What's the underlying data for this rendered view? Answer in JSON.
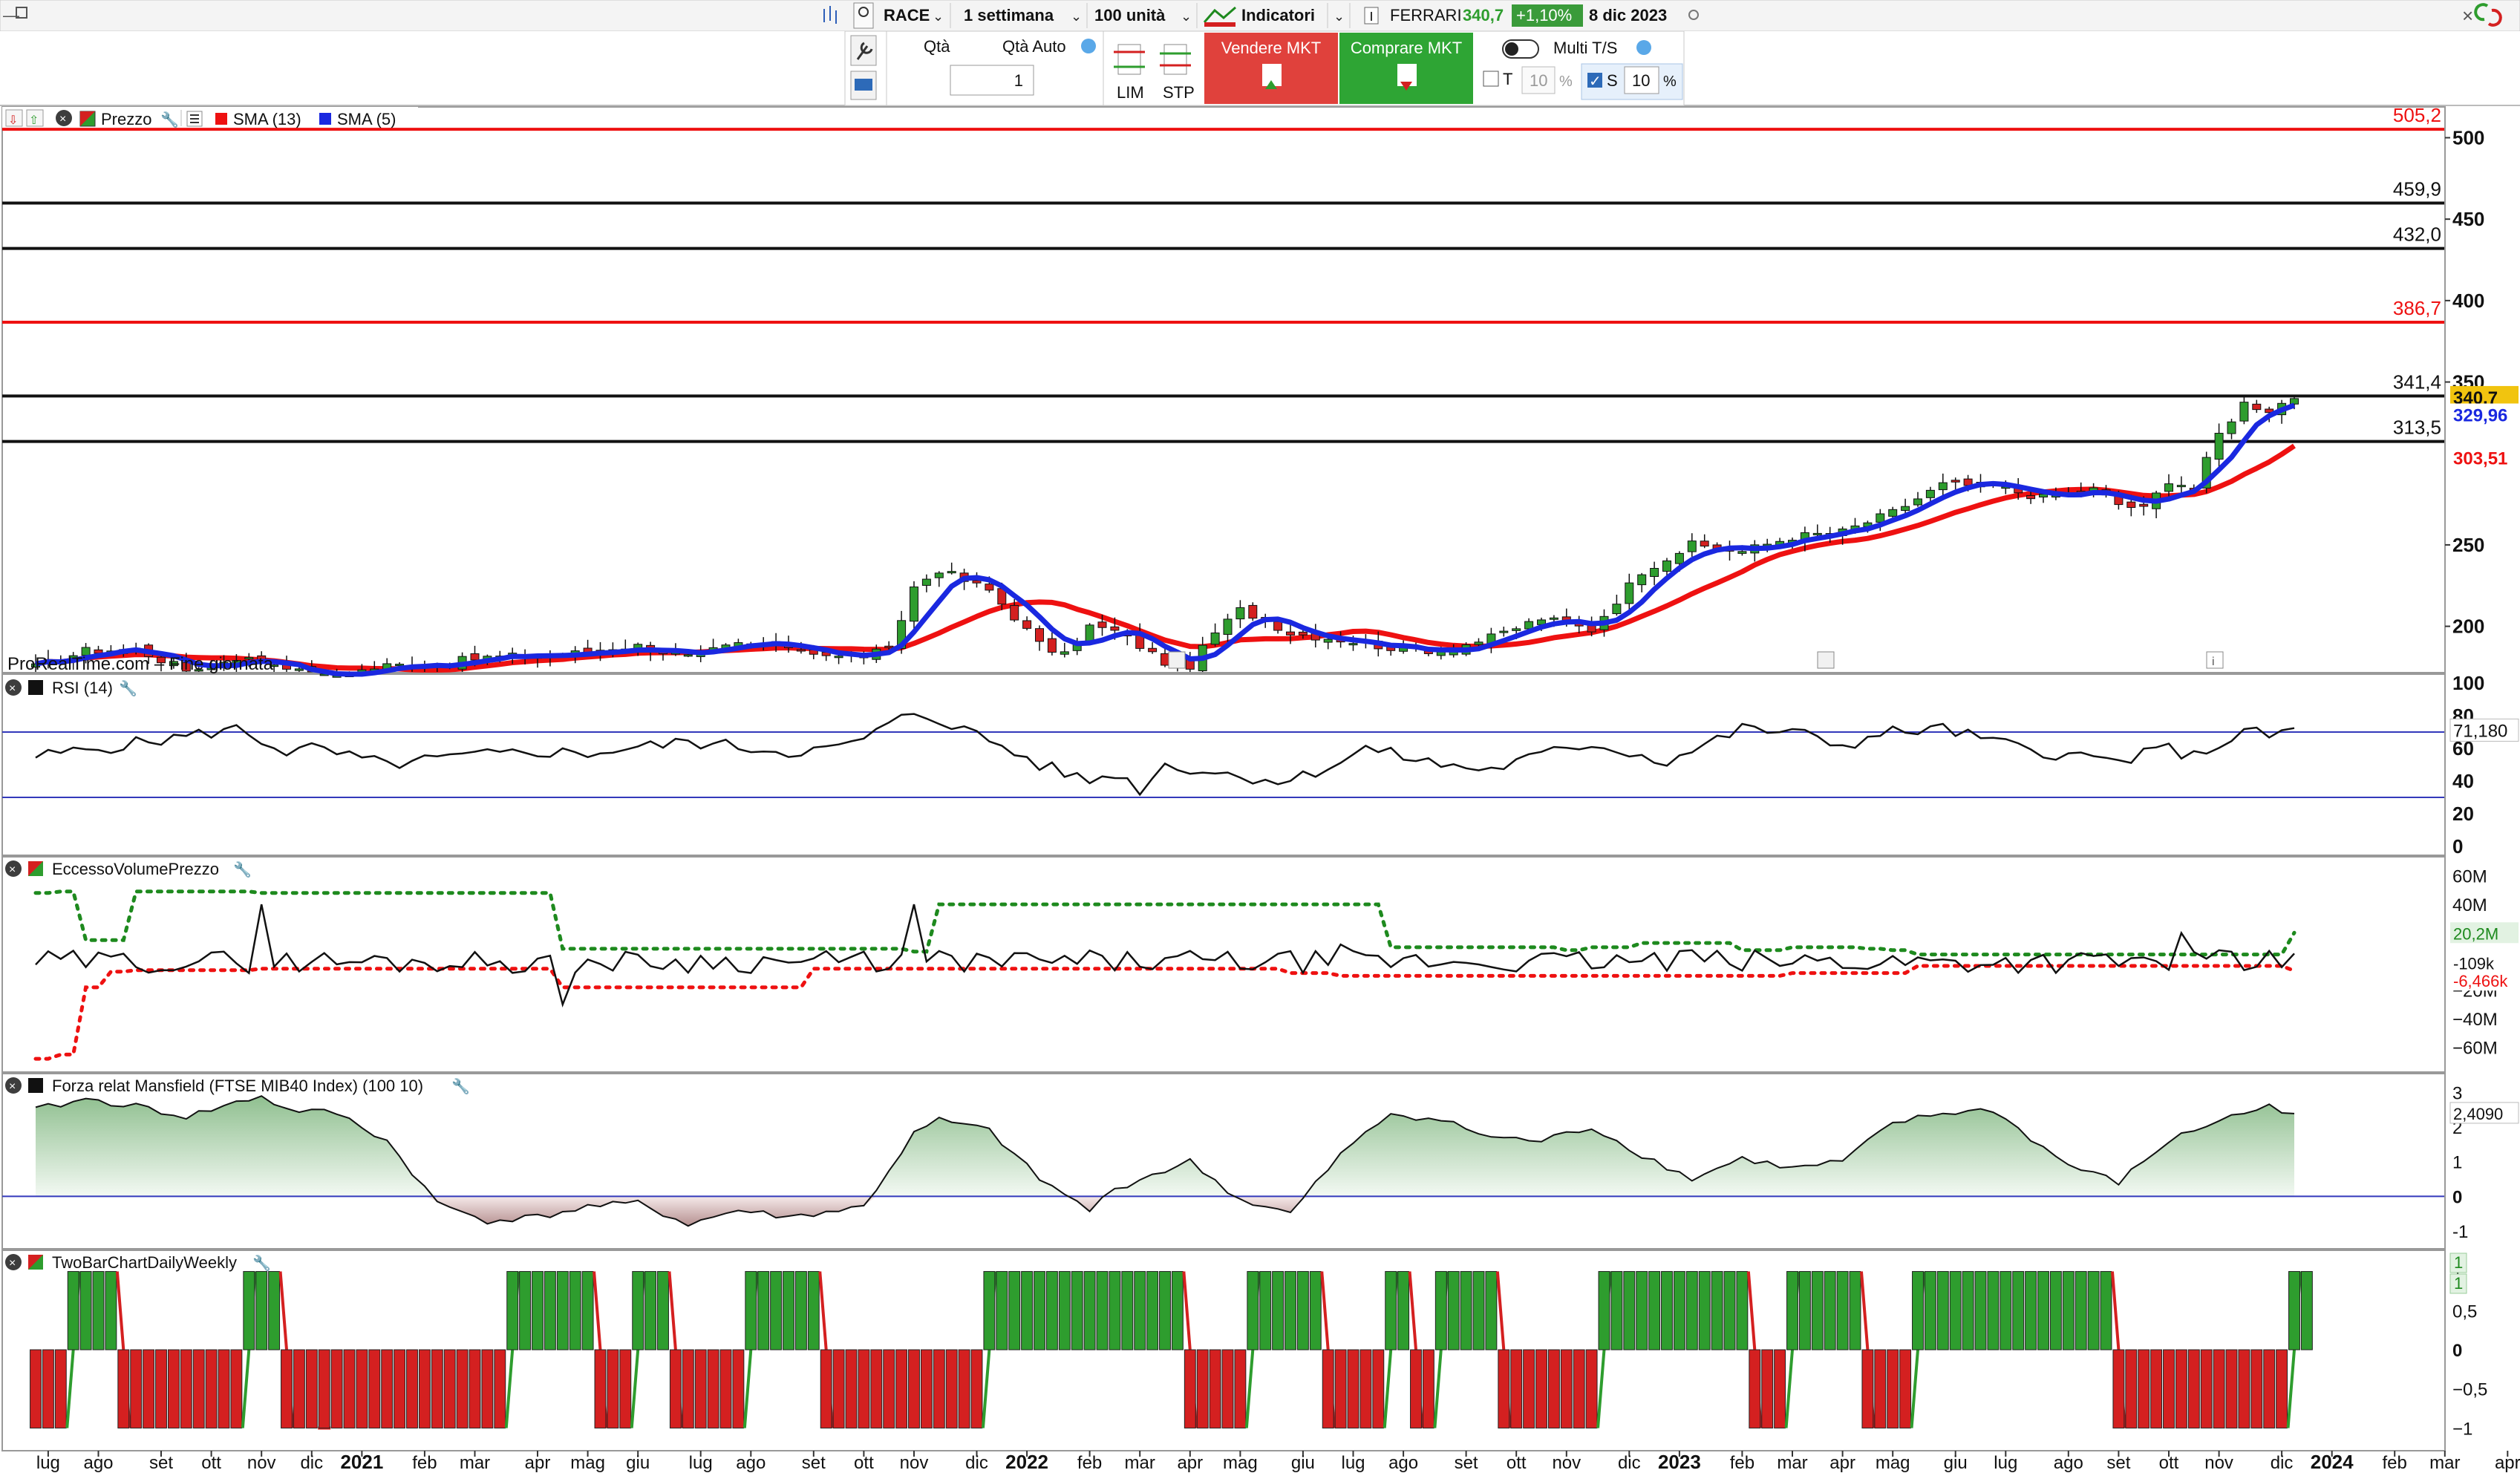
{
  "toolbar": {
    "ticker": "RACE",
    "timeframe": "1 settimana",
    "units": "100 unità",
    "indicators": "Indicatori",
    "name": "FERRARI",
    "price": "340,7",
    "change": "+1,10%",
    "date": "8 dic 2023",
    "qta_label": "Qtà",
    "qta_auto_label": "Qtà Auto",
    "qta_value": "1",
    "lim_label": "LIM",
    "stp_label": "STP",
    "sell_label": "Vendere MKT",
    "buy_label": "Comprare MKT",
    "multi_label": "Multi T/S",
    "t_label": "T",
    "t_value": "10",
    "s_label": "S",
    "s_value": "10",
    "pct": "%"
  },
  "colors": {
    "up": "#2e9d2e",
    "down": "#d42020",
    "sma13": "#ee1111",
    "sma5": "#1a28e0",
    "sell": "#e0413c",
    "buy": "#2ea534",
    "rsi_band": "#3339bb",
    "price_badge": "#f1c40f"
  },
  "chart_data": [
    {
      "type": "candlestick",
      "legend": [
        "Prezzo",
        "SMA (13)",
        "SMA (5)"
      ],
      "watermark": "ProRealTime.com – Fine giornata",
      "x_labels": [
        "lug",
        "ago",
        "set",
        "ott",
        "nov",
        "dic",
        "2021",
        "feb",
        "mar",
        "apr",
        "mag",
        "giu",
        "lug",
        "ago",
        "set",
        "ott",
        "nov",
        "dic",
        "2022",
        "feb",
        "mar",
        "apr",
        "mag",
        "giu",
        "lug",
        "ago",
        "set",
        "ott",
        "nov",
        "dic",
        "2023",
        "feb",
        "mar",
        "apr",
        "mag",
        "giu",
        "lug",
        "ago",
        "set",
        "ott",
        "nov",
        "dic",
        "2024",
        "feb",
        "mar",
        "apr"
      ],
      "x_label_weeks": [
        1,
        5,
        10,
        14,
        18,
        22,
        26,
        31,
        35,
        40,
        44,
        48,
        53,
        57,
        62,
        66,
        70,
        75,
        79,
        84,
        88,
        92,
        96,
        101,
        105,
        109,
        114,
        118,
        122,
        127,
        131,
        136,
        140,
        144,
        148,
        153,
        157,
        162,
        166,
        170,
        174,
        179,
        183,
        188,
        192,
        197
      ],
      "y_range": [
        172,
        518
      ],
      "y_ticks": [
        200,
        250,
        300,
        350,
        400,
        450,
        500
      ],
      "y_tick_labels": [
        "200",
        "250",
        "",
        "350",
        "400",
        "450",
        "500"
      ],
      "levels": [
        {
          "value": 505.2,
          "label": "505,2",
          "color": "red"
        },
        {
          "value": 459.9,
          "label": "459,9",
          "color": "black"
        },
        {
          "value": 432.0,
          "label": "432,0",
          "color": "black"
        },
        {
          "value": 386.7,
          "label": "386,7",
          "color": "red"
        },
        {
          "value": 341.4,
          "label": "341,4",
          "color": "black"
        },
        {
          "value": 313.5,
          "label": "313,5",
          "color": "black"
        }
      ],
      "last_price": "340,7",
      "sma5_last": "329,96",
      "sma13_last": "303,51",
      "anchors_week": [
        0,
        4,
        8,
        12,
        16,
        20,
        22,
        24,
        28,
        32,
        36,
        40,
        44,
        48,
        52,
        56,
        60,
        64,
        68,
        70,
        72,
        74,
        76,
        78,
        80,
        82,
        84,
        86,
        88,
        90,
        92,
        94,
        96,
        98,
        100,
        104,
        108,
        112,
        116,
        120,
        124,
        128,
        132,
        136,
        140,
        144,
        148,
        152,
        156,
        160,
        164,
        166,
        168,
        170,
        172,
        174,
        176,
        178,
        180
      ],
      "anchors_close": [
        175,
        185,
        186,
        173,
        181,
        176,
        168,
        170,
        176,
        177,
        181,
        182,
        184,
        188,
        181,
        189,
        188,
        181,
        185,
        224,
        235,
        228,
        222,
        206,
        189,
        182,
        200,
        197,
        188,
        178,
        176,
        196,
        210,
        204,
        196,
        192,
        187,
        185,
        193,
        205,
        198,
        234,
        250,
        246,
        255,
        258,
        270,
        287,
        286,
        279,
        284,
        275,
        272,
        290,
        285,
        318,
        337,
        333,
        341
      ]
    },
    {
      "type": "line",
      "title": "RSI (14)",
      "y_range": [
        0,
        100
      ],
      "y_ticks": [
        0,
        20,
        40,
        60,
        80,
        100
      ],
      "bands": [
        70,
        30
      ],
      "last": "71,180",
      "anchors_week": [
        0,
        8,
        16,
        20,
        22,
        28,
        34,
        40,
        44,
        52,
        60,
        64,
        66,
        70,
        72,
        76,
        80,
        84,
        86,
        88,
        90,
        96,
        100,
        104,
        106,
        112,
        116,
        120,
        124,
        130,
        136,
        140,
        144,
        148,
        152,
        156,
        160,
        166,
        170,
        172,
        176,
        178,
        180
      ],
      "anchors_value": [
        55,
        63,
        72,
        58,
        60,
        50,
        55,
        58,
        57,
        64,
        58,
        60,
        66,
        82,
        78,
        65,
        50,
        40,
        45,
        35,
        50,
        43,
        40,
        52,
        60,
        50,
        47,
        56,
        63,
        52,
        72,
        70,
        62,
        70,
        72,
        64,
        58,
        52,
        60,
        55,
        70,
        68,
        71
      ]
    },
    {
      "type": "line",
      "title": "EccessoVolumePrezzo",
      "y_range": [
        -70,
        65
      ],
      "y_ticks": [
        60,
        40,
        20,
        0,
        -20,
        -40,
        -60
      ],
      "y_tick_labels": [
        "60M",
        "40M",
        "20M",
        "0",
        "−20M",
        "−40M",
        "−60M"
      ],
      "upper_steps": [
        [
          0,
          48
        ],
        [
          2,
          49
        ],
        [
          4,
          15
        ],
        [
          8,
          49
        ],
        [
          18,
          48
        ],
        [
          20,
          48
        ],
        [
          40,
          48
        ],
        [
          42,
          9
        ],
        [
          70,
          7
        ],
        [
          72,
          40
        ],
        [
          104,
          40
        ],
        [
          108,
          10
        ],
        [
          122,
          8
        ],
        [
          124,
          10
        ],
        [
          128,
          13
        ],
        [
          136,
          8
        ],
        [
          140,
          10
        ],
        [
          146,
          9
        ],
        [
          148,
          8
        ],
        [
          150,
          5
        ],
        [
          180,
          20.2
        ]
      ],
      "lower_steps": [
        [
          0,
          -68
        ],
        [
          2,
          -65
        ],
        [
          4,
          -18
        ],
        [
          6,
          -7
        ],
        [
          8,
          -6
        ],
        [
          18,
          -5
        ],
        [
          42,
          -18
        ],
        [
          60,
          -18
        ],
        [
          62,
          -5
        ],
        [
          100,
          -8
        ],
        [
          104,
          -10
        ],
        [
          140,
          -8
        ],
        [
          150,
          -3
        ],
        [
          180,
          -6.466
        ]
      ],
      "spikes": [
        [
          18,
          40
        ],
        [
          42,
          -30
        ],
        [
          70,
          40
        ],
        [
          104,
          12
        ],
        [
          132,
          8
        ],
        [
          171,
          20
        ],
        [
          176,
          -6
        ]
      ],
      "labels": [
        "20,2M",
        "-109k",
        "-6,466k"
      ]
    },
    {
      "type": "area",
      "title": "Forza relat Mansfield (FTSE MIB40 Index) (100 10)",
      "y_range": [
        -1.3,
        3.2
      ],
      "y_ticks": [
        -1,
        0,
        1,
        2,
        3
      ],
      "last": "2,4090",
      "anchors_week": [
        0,
        4,
        8,
        12,
        16,
        18,
        20,
        24,
        28,
        32,
        36,
        40,
        44,
        48,
        52,
        56,
        60,
        66,
        70,
        72,
        76,
        80,
        84,
        86,
        88,
        92,
        96,
        100,
        104,
        108,
        112,
        116,
        120,
        124,
        128,
        132,
        136,
        140,
        144,
        148,
        152,
        156,
        160,
        162,
        166,
        170,
        174,
        178,
        180
      ],
      "anchors_value": [
        2.5,
        2.8,
        2.6,
        2.3,
        2.7,
        2.9,
        2.5,
        2.4,
        1.6,
        -0.2,
        -0.7,
        -0.6,
        -0.3,
        -0.2,
        -0.8,
        -0.4,
        -0.6,
        -0.3,
        1.8,
        2.2,
        1.9,
        0.5,
        -0.4,
        0.2,
        0.5,
        1.0,
        -0.1,
        -0.5,
        1.2,
        2.4,
        2.2,
        1.7,
        1.6,
        2.0,
        1.2,
        0.5,
        1.1,
        0.8,
        1.0,
        2.1,
        2.4,
        2.5,
        1.4,
        0.9,
        0.4,
        1.6,
        2.2,
        2.6,
        2.4
      ]
    },
    {
      "type": "bar",
      "title": "TwoBarChartDailyWeekly",
      "y_range": [
        -1.1,
        1.1
      ],
      "y_ticks": [
        1,
        0.5,
        0,
        -0.5,
        -1
      ],
      "y_tick_labels": [
        "1",
        "0,5",
        "0",
        "−0,5",
        "−1"
      ],
      "last": [
        "1",
        "1"
      ],
      "segments": [
        [
          0,
          3,
          -1
        ],
        [
          3,
          7,
          1
        ],
        [
          7,
          17,
          -1
        ],
        [
          17,
          20,
          1
        ],
        [
          20,
          23,
          -1
        ],
        [
          23,
          38,
          -1
        ],
        [
          38,
          45,
          1
        ],
        [
          45,
          48,
          -1
        ],
        [
          48,
          51,
          1
        ],
        [
          51,
          57,
          -1
        ],
        [
          57,
          63,
          1
        ],
        [
          63,
          76,
          -1
        ],
        [
          76,
          92,
          1
        ],
        [
          92,
          97,
          -1
        ],
        [
          97,
          103,
          1
        ],
        [
          103,
          108,
          -1
        ],
        [
          108,
          110,
          1
        ],
        [
          110,
          112,
          -1
        ],
        [
          112,
          117,
          1
        ],
        [
          117,
          125,
          -1
        ],
        [
          125,
          137,
          1
        ],
        [
          137,
          140,
          -1
        ],
        [
          140,
          146,
          1
        ],
        [
          146,
          150,
          -1
        ],
        [
          150,
          166,
          1
        ],
        [
          166,
          180,
          -1
        ],
        [
          180,
          182,
          1
        ]
      ]
    }
  ]
}
